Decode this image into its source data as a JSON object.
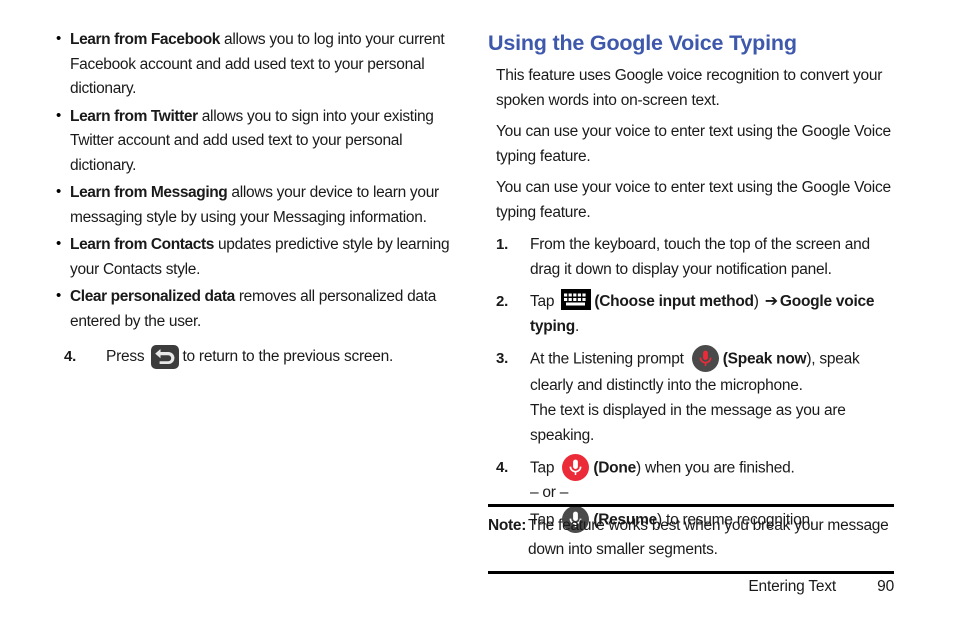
{
  "left_column": {
    "bullets": [
      {
        "lead": "Learn from Facebook",
        "rest": " allows you to log into your current Facebook account and add used text to your personal dictionary."
      },
      {
        "lead": "Learn from Twitter",
        "rest": " allows you to sign into your existing Twitter account and add used text to your personal dictionary."
      },
      {
        "lead": "Learn from Messaging",
        "rest": " allows your device to learn your messaging style by using your Messaging information."
      },
      {
        "lead": "Learn from Contacts",
        "rest": " updates predictive style by learning your Contacts style."
      },
      {
        "lead": "Clear personalized data",
        "rest": " removes all personalized data entered by the user."
      }
    ],
    "step": {
      "number": "4.",
      "text_before": "Press",
      "icon": "back-button-icon",
      "text_after": "to return to the previous screen."
    }
  },
  "right_column": {
    "heading": "Using the Google Voice Typing",
    "heading_color": "#3e58ac",
    "paragraphs": [
      "This feature uses Google voice recognition to convert your spoken words into on-screen text.",
      "You can use your voice to enter text using the Google Voice typing feature.",
      "You can use your voice to enter text using the Google Voice typing feature."
    ],
    "steps": [
      {
        "number": "1.",
        "text": "From the keyboard, touch the top of the screen and drag it down to display your notification panel."
      },
      {
        "number": "2.",
        "text_before": "Tap",
        "icon": "keyboard-icon",
        "label_paren_open": "(",
        "label_bold": "Choose input method",
        "label_paren_close": ")",
        "arrow": "➔",
        "target_bold": "Google voice typing",
        "period": "."
      },
      {
        "number": "3.",
        "text_before": "At the Listening prompt",
        "icon": "mic-speak-now-icon",
        "label_paren_open": "(",
        "label_bold": "Speak now",
        "label_paren_close": "),",
        "text_after": " speak clearly and distinctly into the microphone.",
        "sub_text": "The text is displayed in the message as you are speaking."
      },
      {
        "number": "4.",
        "text_before": "Tap",
        "icon": "mic-done-icon",
        "label_paren_open": "(",
        "label_bold": "Done",
        "label_paren_close": ")",
        "text_after": " when you are finished.",
        "or_text": "– or –",
        "alt_text_before": "Tap",
        "alt_icon": "mic-resume-icon",
        "alt_label_paren_open": "(",
        "alt_label_bold": "Resume",
        "alt_label_paren_close": ")",
        "alt_text_after": " to resume recognition."
      }
    ]
  },
  "note": {
    "label": "Note:",
    "text": "The feature works best when you break your message down into smaller segments."
  },
  "footer": {
    "chapter": "Entering Text",
    "page_number": "90"
  },
  "colors": {
    "heading_blue": "#3e58ac",
    "mic_red": "#ec2b38",
    "mic_dark": "#4a4a4a",
    "icon_black": "#000000",
    "back_key": "#3c3c3c"
  }
}
